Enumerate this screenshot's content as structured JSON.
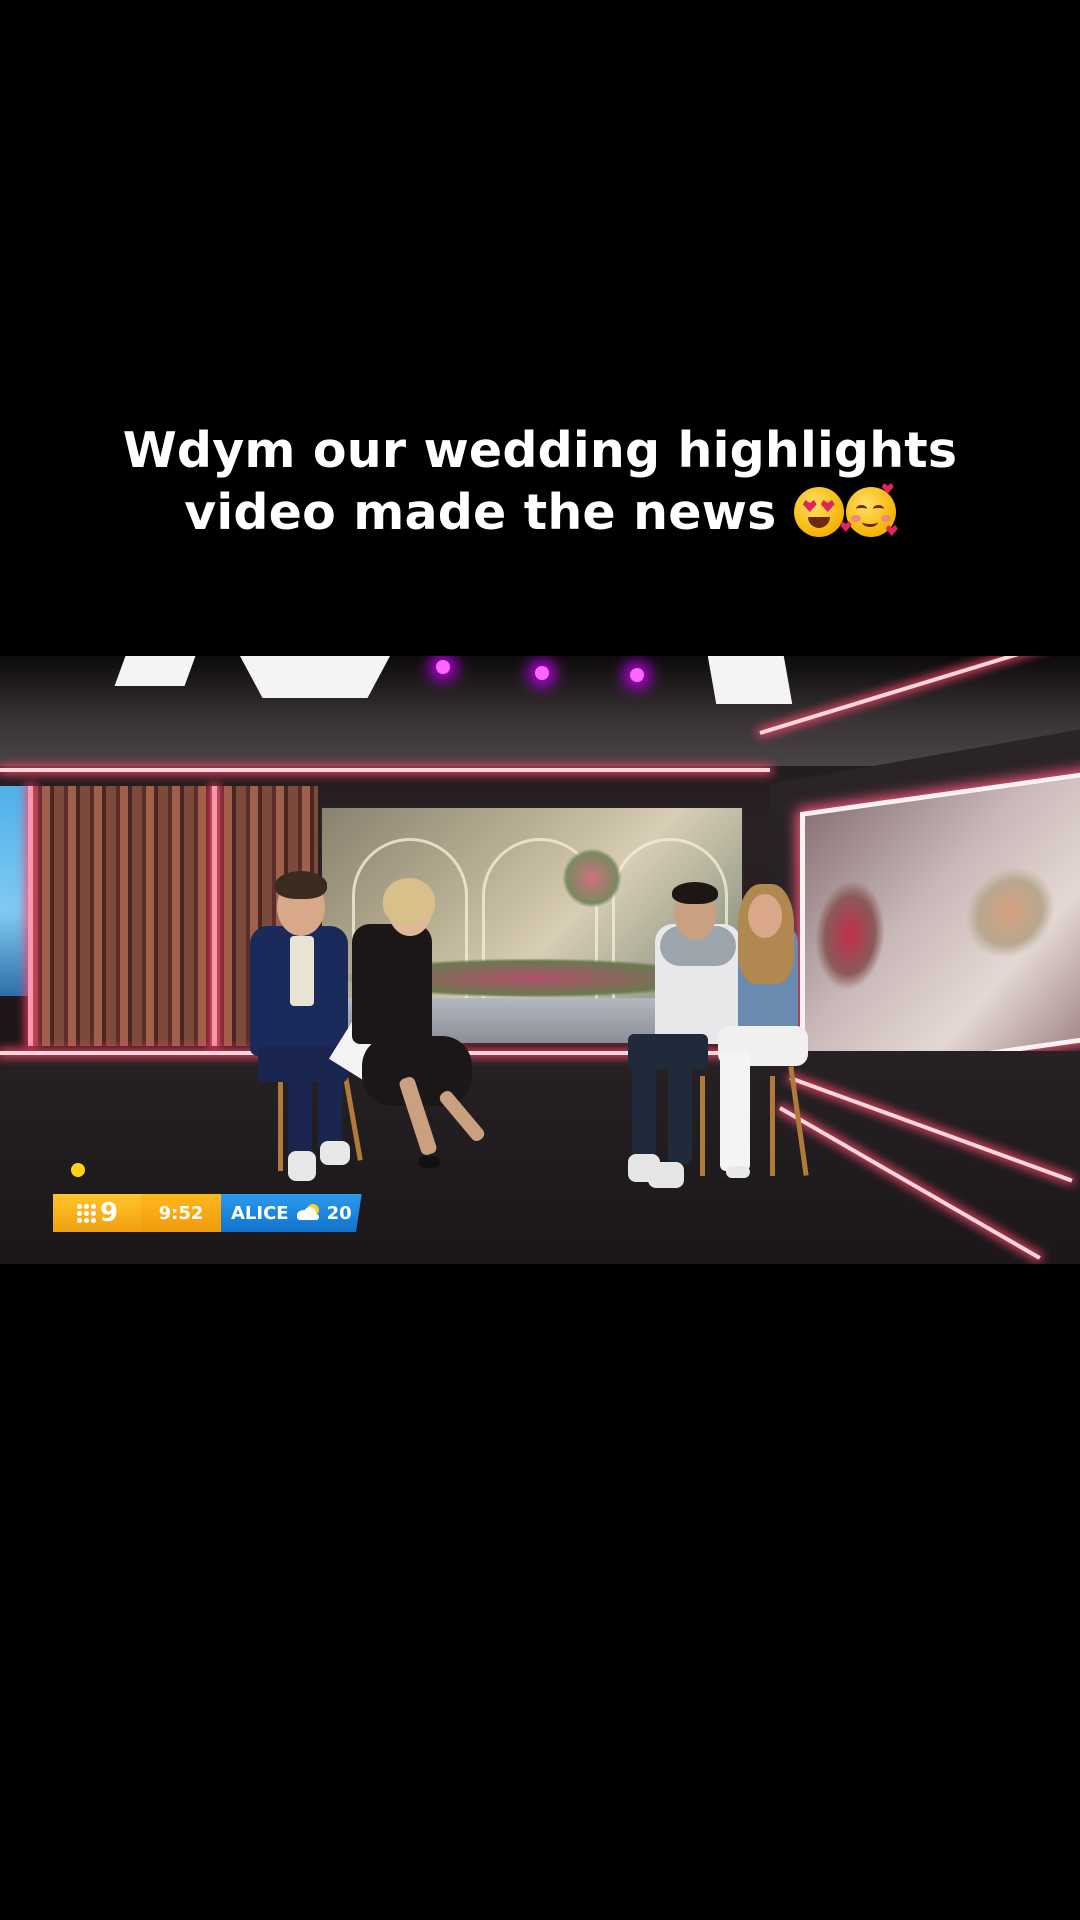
{
  "caption": {
    "line1": "Wdym our wedding highlights",
    "line2": "video made the news",
    "emojis": [
      "smiling-face-with-heart-eyes",
      "smiling-face-with-hearts"
    ]
  },
  "broadcast_bug": {
    "channel_logo": "9",
    "time": "9:52",
    "city": "ALICE",
    "weather_icon": "partly-cloudy-icon",
    "temperature": "20",
    "logo_color": "#f5b21a",
    "weather_color": "#1e8ae6"
  }
}
